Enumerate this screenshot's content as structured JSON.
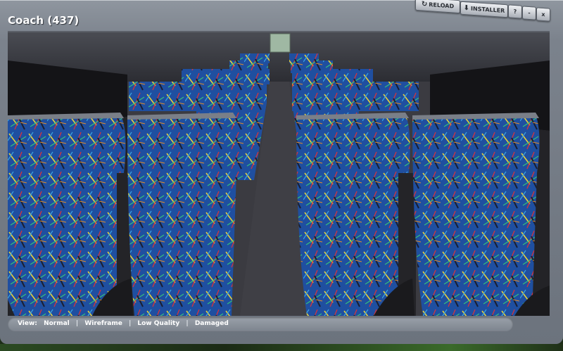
{
  "window": {
    "title": "Coach (437)"
  },
  "toolbar": {
    "reload_label": "RELOAD",
    "installer_label": "INSTALLER",
    "help_label": "?",
    "minimize_label": "-",
    "close_label": "x"
  },
  "status": {
    "view_label": "View:",
    "options": [
      "Normal",
      "Wireframe",
      "Low Quality",
      "Damaged"
    ],
    "separator": "|"
  },
  "colors": {
    "seat_fabric": "#1f4fa0",
    "interior_floor": "#3b3b41",
    "chrome": "#7b828c"
  },
  "icons": {
    "reload": "reload-icon",
    "installer": "download-icon"
  }
}
